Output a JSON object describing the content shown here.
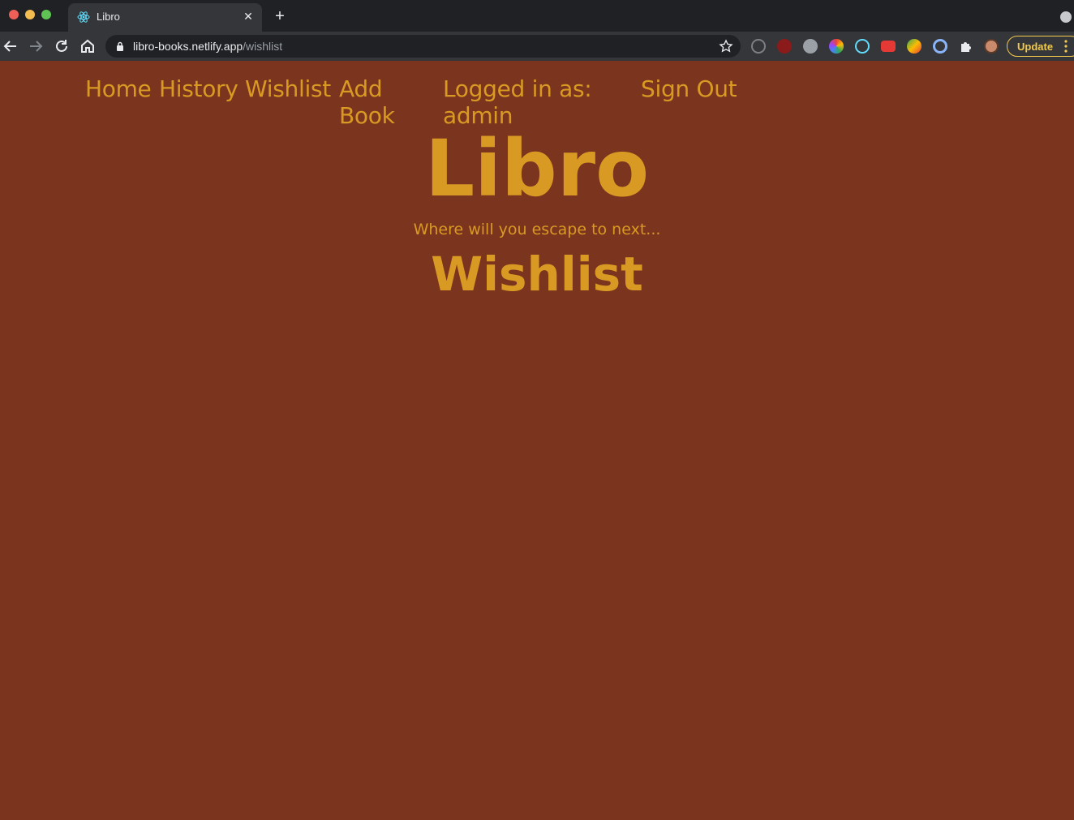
{
  "browser": {
    "tab_title": "Libro",
    "url_host": "libro-books.netlify.app",
    "url_path": "/wishlist",
    "update_label": "Update",
    "new_tab_glyph": "+",
    "close_glyph": "✕"
  },
  "nav": {
    "home": "Home",
    "history": "History",
    "wishlist": "Wishlist",
    "add_book": "Add Book",
    "logged_in": "Logged in as: admin",
    "sign_out": "Sign Out"
  },
  "header": {
    "title": "Libro",
    "tagline": "Where will you escape to next..."
  },
  "main": {
    "heading": "Wishlist"
  },
  "colors": {
    "background": "#7b341e",
    "accent": "#d99a23"
  }
}
